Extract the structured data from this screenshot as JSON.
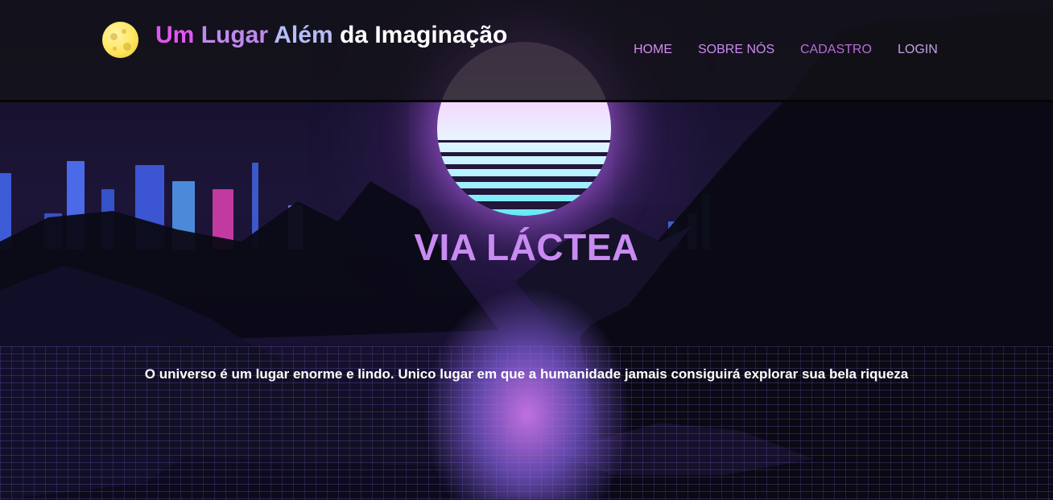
{
  "brand": {
    "icon": "moon-icon",
    "words": [
      "Um",
      "Lugar",
      "Além",
      "da Imaginação"
    ],
    "colors": [
      "#e057f2",
      "#c089ee",
      "#b4bdf6",
      "#ffffff"
    ]
  },
  "nav": {
    "items": [
      {
        "label": "HOME",
        "color": "#d58cf0"
      },
      {
        "label": "SOBRE NÓS",
        "color": "#c98bf2"
      },
      {
        "label": "CADASTRO",
        "color": "#b96cd8"
      },
      {
        "label": "LOGIN",
        "color": "#c3a1e6"
      }
    ]
  },
  "hero": {
    "title": "VIA LÁCTEA",
    "tagline": "O universo é um lugar enorme e lindo. Unico lugar em que a humanidade jamais consiguirá explorar sua bela riqueza"
  }
}
